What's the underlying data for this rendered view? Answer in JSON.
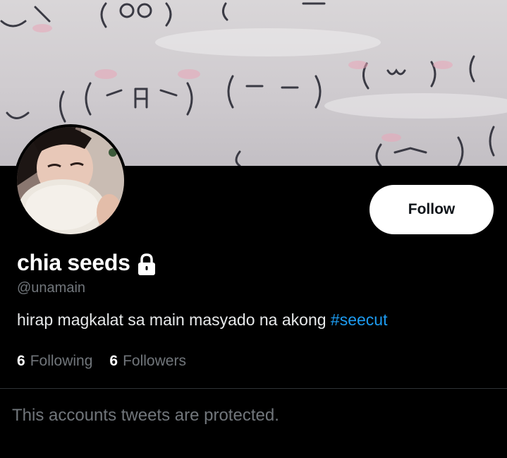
{
  "profile": {
    "display_name": "chia seeds",
    "handle": "@unamain",
    "bio_text": "hirap magkalat sa main masyado na akong ",
    "bio_hashtag": "#seecut",
    "following_count": "6",
    "following_label": "Following",
    "followers_count": "6",
    "followers_label": "Followers",
    "locked_icon": "lock-icon"
  },
  "actions": {
    "follow_label": "Follow"
  },
  "timeline": {
    "protected_message": "This accounts tweets are protected."
  },
  "colors": {
    "background": "#000000",
    "link": "#1d9bf0",
    "secondary_text": "#71767b",
    "divider": "#2f3336"
  }
}
